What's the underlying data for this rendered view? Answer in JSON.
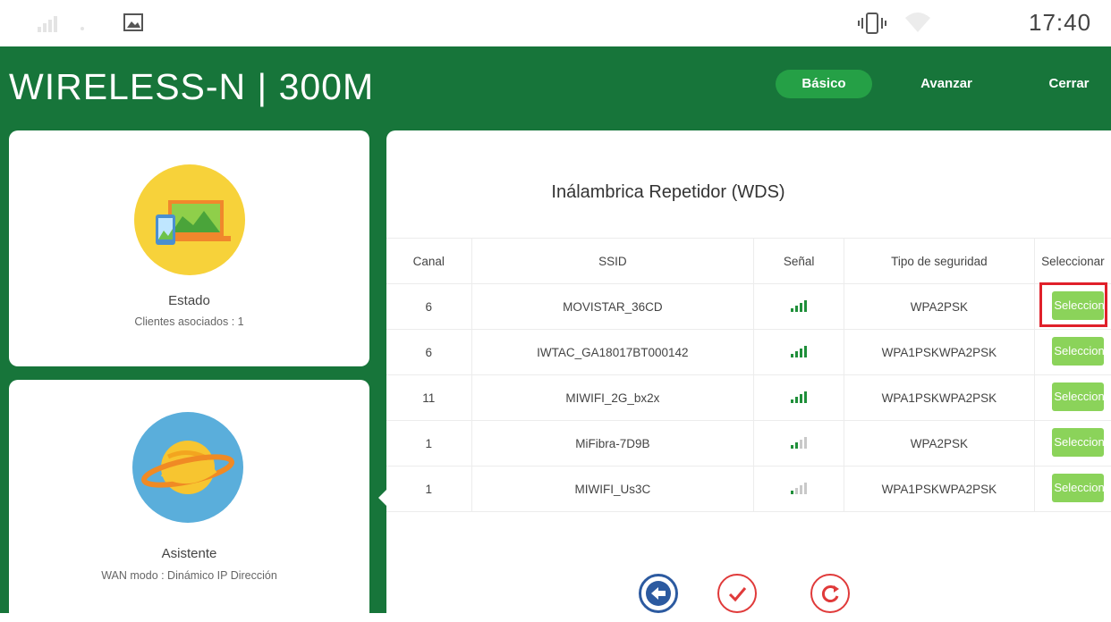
{
  "status_bar": {
    "time": "17:40"
  },
  "header": {
    "brand": "WIRELESS-N | 300M",
    "nav": [
      {
        "label": "Básico",
        "active": true
      },
      {
        "label": "Avanzar",
        "active": false
      },
      {
        "label": "Cerrar",
        "active": false
      }
    ]
  },
  "cards": {
    "estado": {
      "title": "Estado",
      "subtitle": "Clientes asociados : 1",
      "icon": "device-screens-icon"
    },
    "asistente": {
      "title": "Asistente",
      "subtitle": "WAN modo : Dinámico IP Dirección",
      "icon": "planet-icon"
    }
  },
  "panel": {
    "title": "Inálambrica Repetidor (WDS)",
    "columns": [
      "Canal",
      "SSID",
      "Señal",
      "Tipo de seguridad",
      "Seleccionar"
    ],
    "rows": [
      {
        "canal": "6",
        "ssid": "MOVISTAR_36CD",
        "signal": 4,
        "security": "WPA2PSK",
        "button": "Seleccionar"
      },
      {
        "canal": "6",
        "ssid": "IWTAC_GA18017BT000142",
        "signal": 4,
        "security": "WPA1PSKWPA2PSK",
        "button": "Seleccionar"
      },
      {
        "canal": "11",
        "ssid": "MIWIFI_2G_bx2x",
        "signal": 4,
        "security": "WPA1PSKWPA2PSK",
        "button": "Seleccionar"
      },
      {
        "canal": "1",
        "ssid": "MiFibra-7D9B",
        "signal": 2,
        "security": "WPA2PSK",
        "button": "Seleccionar"
      },
      {
        "canal": "1",
        "ssid": "MIWIFI_Us3C",
        "signal": 1,
        "security": "WPA1PSKWPA2PSK",
        "button": "Seleccionar"
      }
    ]
  },
  "colors": {
    "brand_green": "#17753a",
    "active_nav": "#25a046",
    "select_button": "#8bd35a",
    "highlight": "#e0202a"
  }
}
